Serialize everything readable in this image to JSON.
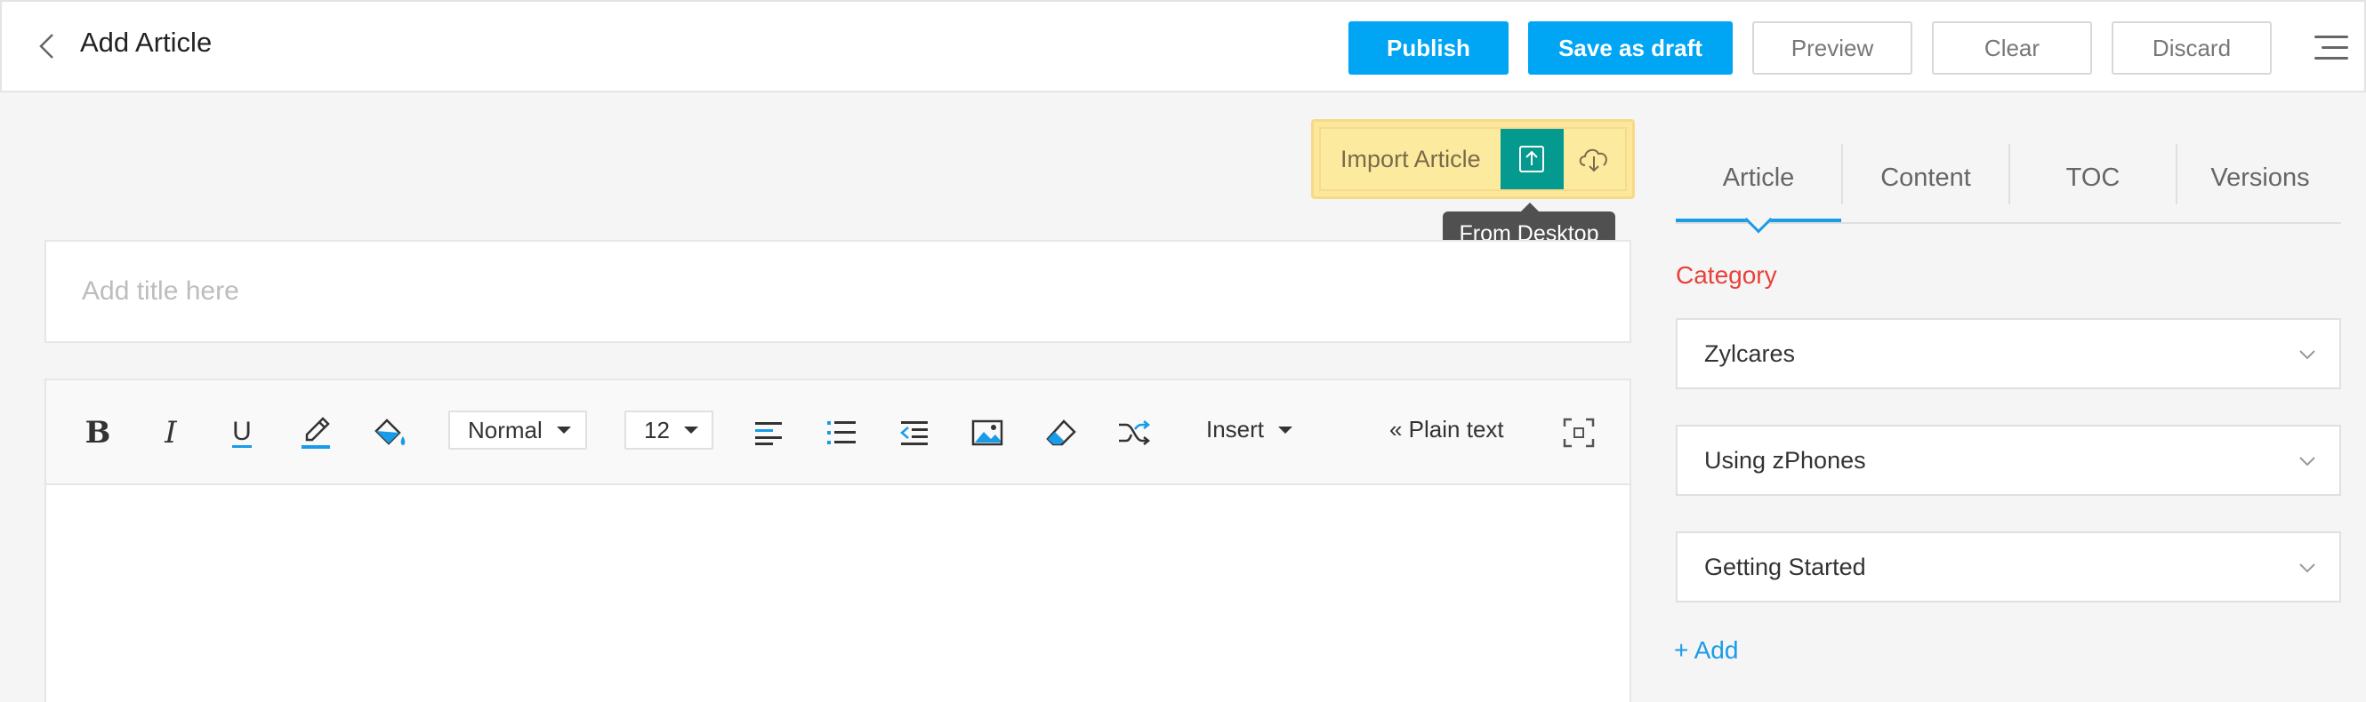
{
  "header": {
    "title": "Add Article",
    "buttons": {
      "publish": "Publish",
      "save_draft": "Save as draft",
      "preview": "Preview",
      "clear": "Clear",
      "discard": "Discard"
    }
  },
  "import": {
    "label": "Import Article",
    "tooltip": "From Desktop",
    "icons": [
      "upload-icon",
      "cloud-download-icon"
    ]
  },
  "editor": {
    "title_placeholder": "Add title here",
    "toolbar": {
      "format_value": "Normal",
      "size_value": "12",
      "insert_label": "Insert",
      "plain_text_label": "« Plain text",
      "icons": [
        "bold-icon",
        "italic-icon",
        "underline-icon",
        "text-color-icon",
        "fill-color-icon",
        "align-left-icon",
        "bullet-list-icon",
        "outdent-icon",
        "image-icon",
        "eraser-icon",
        "shuffle-icon",
        "fullscreen-icon"
      ]
    }
  },
  "sidepanel": {
    "tabs": [
      "Article",
      "Content",
      "TOC",
      "Versions"
    ],
    "active_tab": "Article",
    "category_label": "Category",
    "categories": [
      "Zylcares",
      "Using zPhones",
      "Getting Started"
    ],
    "add_label": "+ Add"
  },
  "colors": {
    "primary": "#00a5f4",
    "accent_teal": "#059a8f",
    "import_bg": "#fde79b",
    "category_label": "#e8413b",
    "link": "#1a9be8"
  }
}
